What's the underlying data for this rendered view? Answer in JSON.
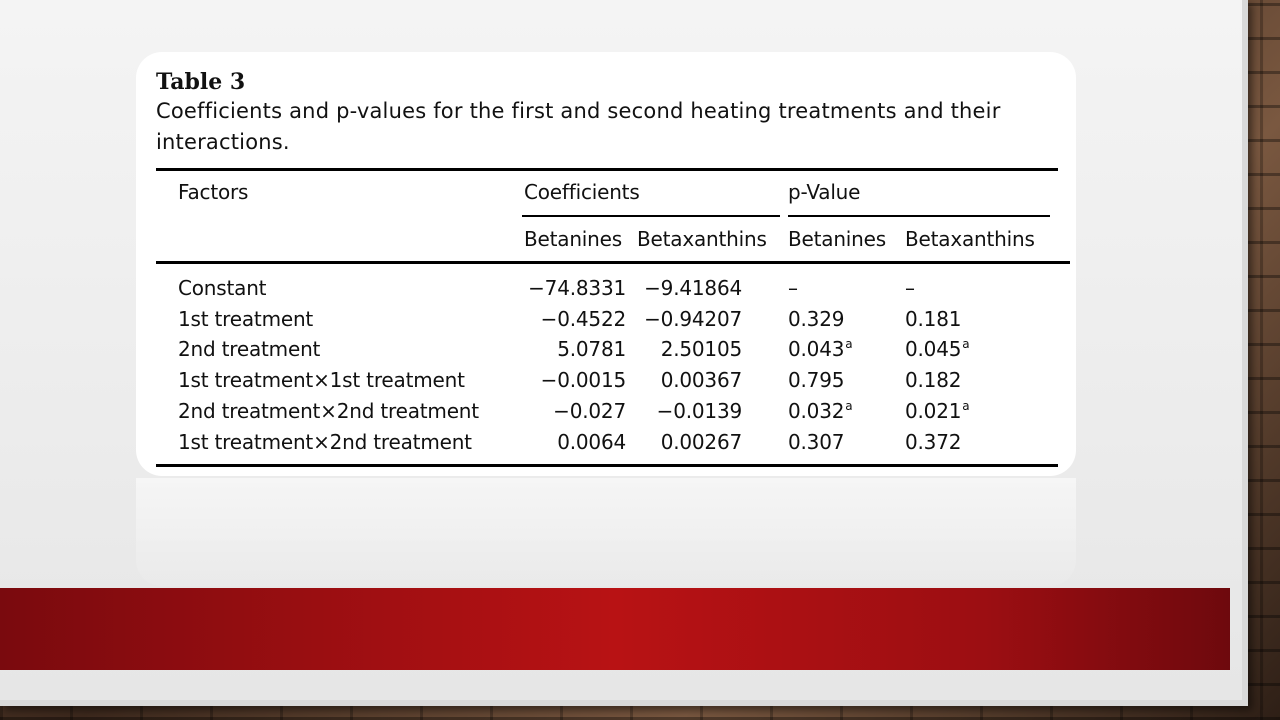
{
  "table": {
    "number": "Table 3",
    "caption_line1": "Coefficients and p-values for the first and second heating treatments and their",
    "caption_line2": "interactions.",
    "headers": {
      "factors": "Factors",
      "coefficients": "Coefficients",
      "pvalue": "p-Value",
      "sub": [
        "Betanines",
        "Betaxanthins",
        "Betanines",
        "Betaxanthins"
      ]
    },
    "rows": [
      {
        "factor": "Constant",
        "coef_betanines": "−74.8331",
        "coef_betaxanthins": "−9.41864",
        "p_betanines": "–",
        "p_betanines_sup": "",
        "p_betaxanthins": "–",
        "p_betaxanthins_sup": ""
      },
      {
        "factor": "1st treatment",
        "coef_betanines": "−0.4522",
        "coef_betaxanthins": "−0.94207",
        "p_betanines": "0.329",
        "p_betanines_sup": "",
        "p_betaxanthins": "0.181",
        "p_betaxanthins_sup": ""
      },
      {
        "factor": "2nd treatment",
        "coef_betanines": "5.0781",
        "coef_betaxanthins": "2.50105",
        "p_betanines": "0.043",
        "p_betanines_sup": "a",
        "p_betaxanthins": "0.045",
        "p_betaxanthins_sup": "a"
      },
      {
        "factor": "1st treatment×1st treatment",
        "coef_betanines": "−0.0015",
        "coef_betaxanthins": "0.00367",
        "p_betanines": "0.795",
        "p_betanines_sup": "",
        "p_betaxanthins": "0.182",
        "p_betaxanthins_sup": ""
      },
      {
        "factor": "2nd treatment×2nd treatment",
        "coef_betanines": "−0.027",
        "coef_betaxanthins": "−0.0139",
        "p_betanines": "0.032",
        "p_betanines_sup": "a",
        "p_betaxanthins": "0.021",
        "p_betaxanthins_sup": "a"
      },
      {
        "factor": "1st treatment×2nd treatment",
        "coef_betanines": "0.0064",
        "coef_betaxanthins": "0.00267",
        "p_betanines": "0.307",
        "p_betanines_sup": "",
        "p_betaxanthins": "0.372",
        "p_betaxanthins_sup": ""
      }
    ]
  },
  "colors": {
    "banner": "#b81214",
    "slide_bg": "#f0f0f0",
    "card_bg": "#ffffff"
  }
}
